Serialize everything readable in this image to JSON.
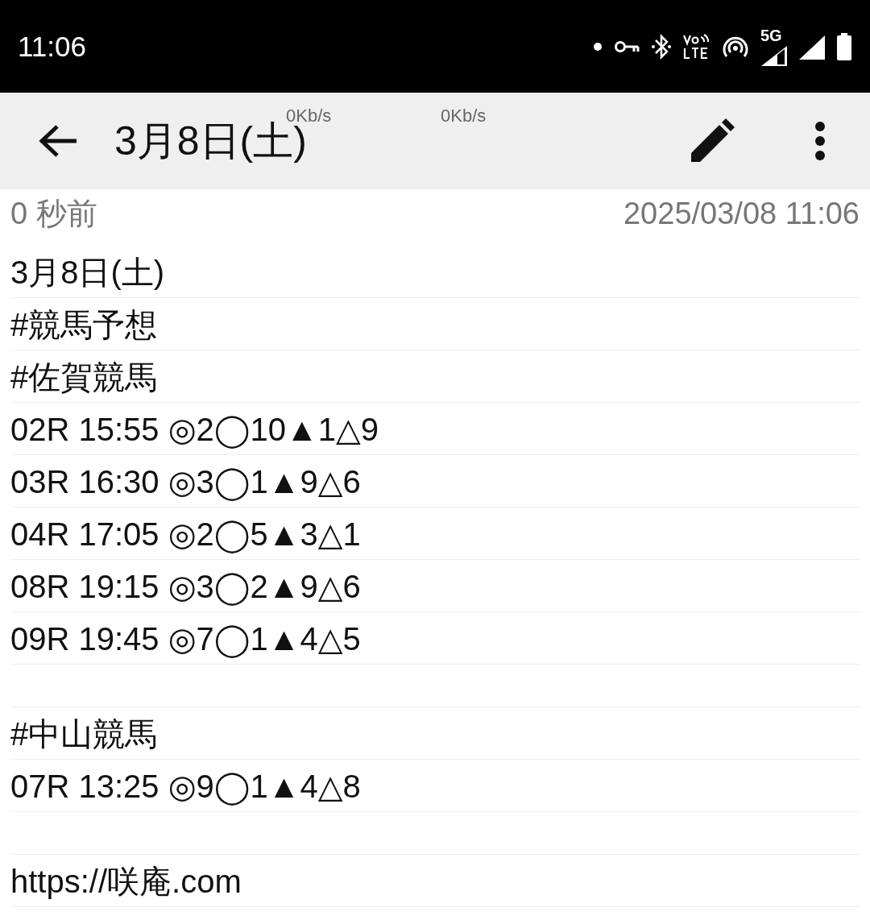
{
  "status_bar": {
    "time": "11:06",
    "network_type": "5G"
  },
  "speed_overlays": [
    "0Kb/s",
    "0Kb/s"
  ],
  "toolbar": {
    "title": "3月8日(土)"
  },
  "meta": {
    "relative_time": "0 秒前",
    "timestamp": "2025/03/08 11:06"
  },
  "note_lines": [
    {
      "kind": "text",
      "text": "3月8日(土)"
    },
    {
      "kind": "text",
      "text": "#競馬予想"
    },
    {
      "kind": "text",
      "text": "#佐賀競馬"
    },
    {
      "kind": "text",
      "text": "02R 15:55 ◎2◯10▲1△9"
    },
    {
      "kind": "text",
      "text": "03R 16:30 ◎3◯1▲9△6"
    },
    {
      "kind": "text",
      "text": "04R 17:05 ◎2◯5▲3△1"
    },
    {
      "kind": "text",
      "text": "08R 19:15 ◎3◯2▲9△6"
    },
    {
      "kind": "text",
      "text": "09R 19:45 ◎7◯1▲4△5"
    },
    {
      "kind": "blank"
    },
    {
      "kind": "text",
      "text": "#中山競馬"
    },
    {
      "kind": "text",
      "text": "07R 13:25 ◎9◯1▲4△8"
    },
    {
      "kind": "blank"
    },
    {
      "kind": "text",
      "text": "https://咲庵.com"
    }
  ]
}
